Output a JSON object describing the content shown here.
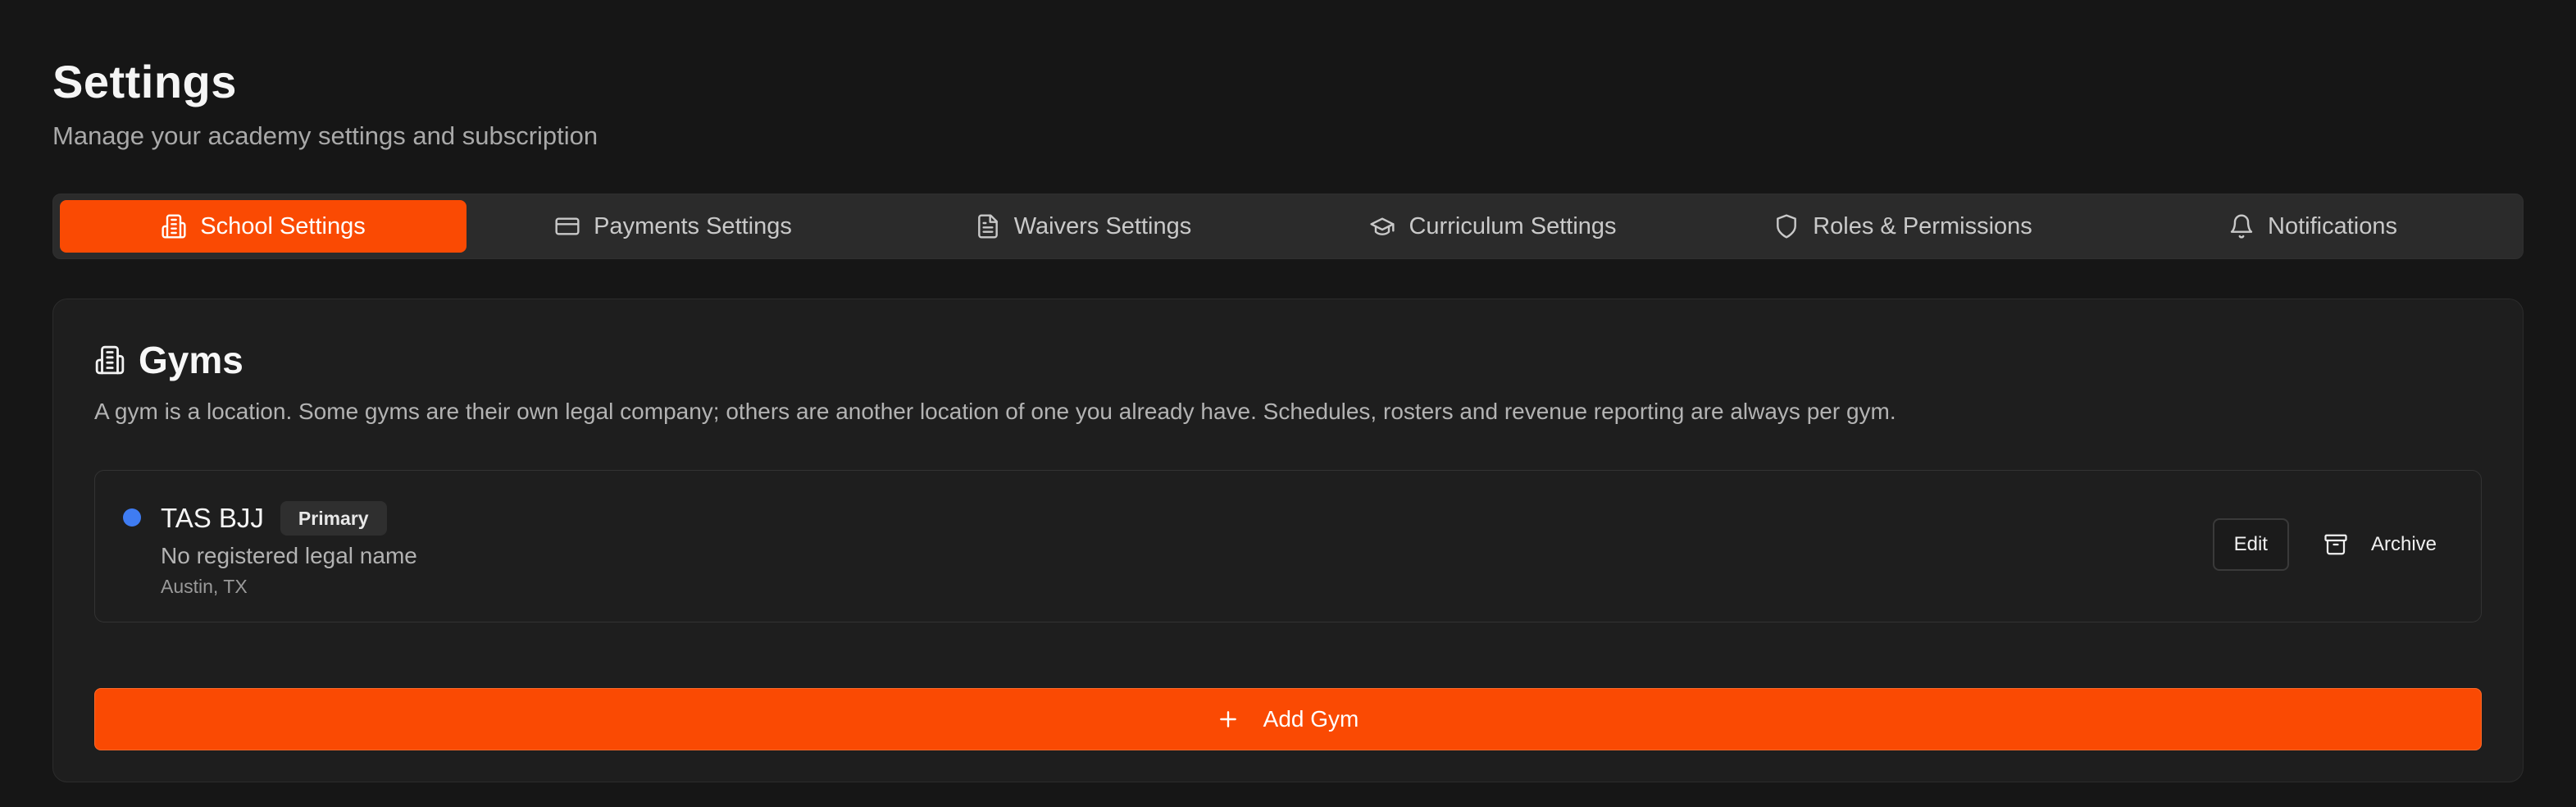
{
  "header": {
    "title": "Settings",
    "subtitle": "Manage your academy settings and subscription"
  },
  "tabs": [
    {
      "label": "School Settings",
      "icon": "building-icon",
      "active": true
    },
    {
      "label": "Payments Settings",
      "icon": "credit-card-icon",
      "active": false
    },
    {
      "label": "Waivers Settings",
      "icon": "document-icon",
      "active": false
    },
    {
      "label": "Curriculum Settings",
      "icon": "graduation-cap-icon",
      "active": false
    },
    {
      "label": "Roles & Permissions",
      "icon": "shield-icon",
      "active": false
    },
    {
      "label": "Notifications",
      "icon": "bell-icon",
      "active": false
    }
  ],
  "gyms_card": {
    "title": "Gyms",
    "icon": "building-icon",
    "description": "A gym is a location. Some gyms are their own legal company; others are another location of one you already have. Schedules, rosters and revenue reporting are always per gym.",
    "gyms": [
      {
        "name": "TAS BJJ",
        "badge": "Primary",
        "legal_name": "No registered legal name",
        "location": "Austin, TX",
        "status_color": "#3f7cf2",
        "edit_label": "Edit",
        "archive_label": "Archive"
      }
    ],
    "add_label": "Add Gym"
  },
  "colors": {
    "accent": "#fa4a03",
    "background": "#161616",
    "card": "#1e1e1e",
    "status_dot": "#3f7cf2"
  }
}
